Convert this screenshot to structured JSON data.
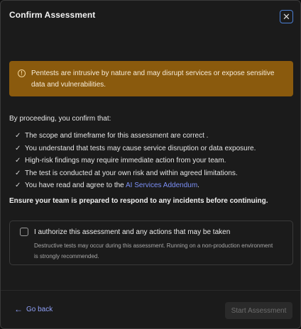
{
  "dialog": {
    "title": "Confirm Assessment",
    "close_icon": "close-icon"
  },
  "warning": {
    "icon": "warning-circle-icon",
    "text": "Pentests are intrusive by nature and may disrupt services or expose sensitive data and vulnerabilities.",
    "color": "#8a5a0d"
  },
  "confirmation": {
    "intro": "By proceeding, you confirm that:",
    "items": [
      {
        "pre": "The scope and timeframe for this assessment are correct .",
        "link": "",
        "post": ""
      },
      {
        "pre": "You understand that tests may cause service disruption or data exposure.",
        "link": "",
        "post": ""
      },
      {
        "pre": "High-risk findings may require immediate action from your team.",
        "link": "",
        "post": ""
      },
      {
        "pre": "The test is conducted at your own risk and within agreed limitations.",
        "link": "",
        "post": ""
      },
      {
        "pre": "You have read and agree to the ",
        "link": "AI Services Addendum",
        "post": "."
      }
    ],
    "emphasis": "Ensure your team is prepared to respond to any incidents before continuing."
  },
  "authorization": {
    "checked": false,
    "label": "I authorize this assessment and any actions that may be taken",
    "note": "Destructive tests may occur during this assessment. Running on a non-production environment is strongly recommended."
  },
  "footer": {
    "back_label": "Go back",
    "start_label": "Start Assessment",
    "start_disabled": true
  },
  "colors": {
    "accent_link": "#7b8ff5",
    "focus_ring": "#4a7fd4"
  }
}
